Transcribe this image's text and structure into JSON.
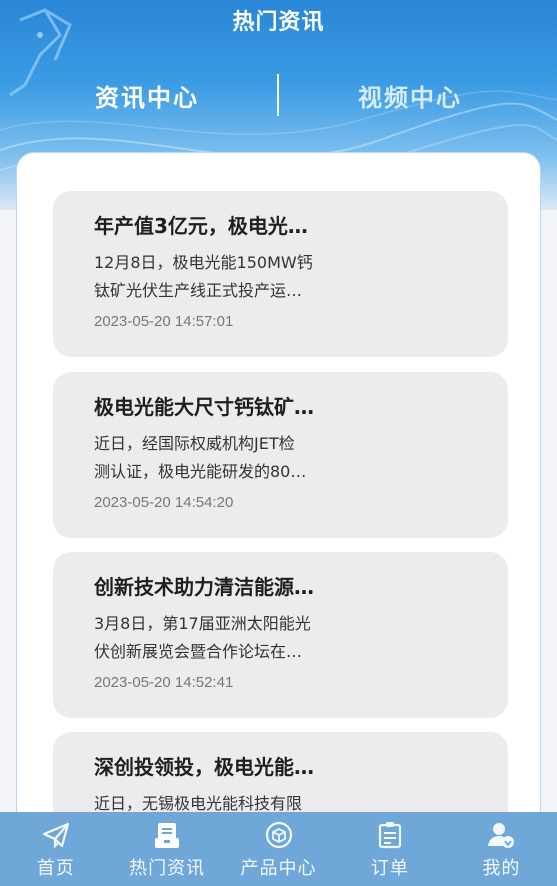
{
  "header": {
    "title": "热门资讯"
  },
  "tabs": [
    {
      "label": "资讯中心",
      "active": true
    },
    {
      "label": "视频中心",
      "active": false
    }
  ],
  "articles": [
    {
      "title": "年产值3亿元，极电光…",
      "summary": "12月8日，极电光能150MW钙\n钛矿光伏生产线正式投产运…",
      "time": "2023-05-20 14:57:01"
    },
    {
      "title": "极电光能大尺寸钙钛矿…",
      "summary": "近日，经国际权威机构JET检\n测认证，极电光能研发的80…",
      "time": "2023-05-20 14:54:20"
    },
    {
      "title": "创新技术助力清洁能源…",
      "summary": "3月8日，第17届亚洲太阳能光\n伏创新展览会暨合作论坛在…",
      "time": "2023-05-20 14:52:41"
    },
    {
      "title": "深创投领投，极电光能…",
      "summary": "近日，无锡极电光能科技有限",
      "time": ""
    }
  ],
  "tabbar": [
    {
      "label": "首页",
      "icon": "paper-plane-icon"
    },
    {
      "label": "热门资讯",
      "icon": "news-icon"
    },
    {
      "label": "产品中心",
      "icon": "product-box-icon"
    },
    {
      "label": "订单",
      "icon": "order-icon"
    },
    {
      "label": "我的",
      "icon": "user-icon"
    }
  ],
  "colors": {
    "accent": "#2a86d6",
    "tabbar": "#6ea7d8",
    "card": "#ececec"
  }
}
